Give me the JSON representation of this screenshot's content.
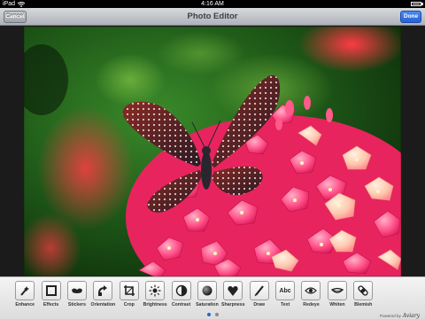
{
  "status_bar": {
    "device": "iPad",
    "time": "4:16 AM"
  },
  "navbar": {
    "title": "Photo Editor",
    "cancel_label": "Cancel",
    "done_label": "Done"
  },
  "toolbar": {
    "tools": [
      {
        "label": "Enhance",
        "icon": "enhance-icon"
      },
      {
        "label": "Effects",
        "icon": "effects-icon"
      },
      {
        "label": "Stickers",
        "icon": "stickers-icon"
      },
      {
        "label": "Orientation",
        "icon": "orientation-icon"
      },
      {
        "label": "Crop",
        "icon": "crop-icon"
      },
      {
        "label": "Brightness",
        "icon": "brightness-icon"
      },
      {
        "label": "Contrast",
        "icon": "contrast-icon"
      },
      {
        "label": "Saturation",
        "icon": "saturation-icon"
      },
      {
        "label": "Sharpness",
        "icon": "sharpness-icon"
      },
      {
        "label": "Draw",
        "icon": "draw-icon"
      },
      {
        "label": "Text",
        "icon": "text-icon"
      },
      {
        "label": "Redeye",
        "icon": "redeye-icon"
      },
      {
        "label": "Whiten",
        "icon": "whiten-icon"
      },
      {
        "label": "Blemish",
        "icon": "blemish-icon"
      }
    ],
    "text_icon_glyph": "Abc",
    "powered_by": "Powered by",
    "powered_brand": "Aviary",
    "page_count": 2,
    "active_page": 1
  },
  "colors": {
    "done": "#2562d8",
    "active_dot": "#2d63c9"
  }
}
